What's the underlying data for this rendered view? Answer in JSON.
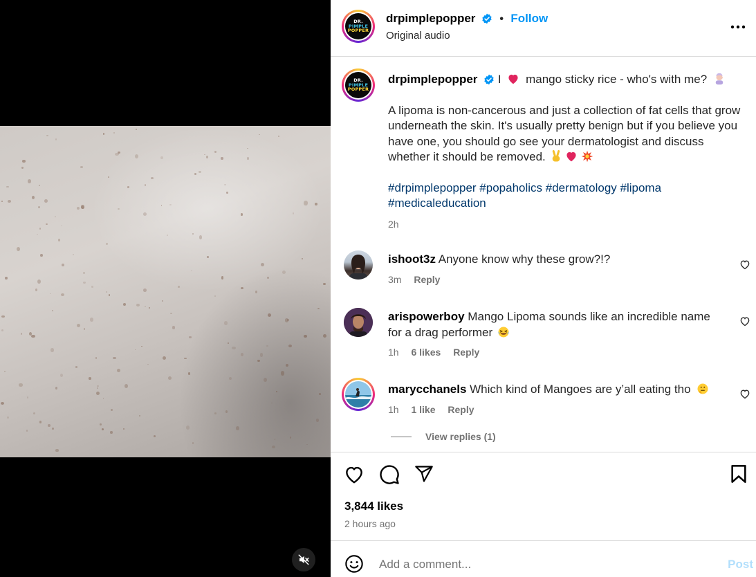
{
  "post": {
    "author": "drpimplepopper",
    "follow_label": "Follow",
    "audio": "Original audio",
    "avatar_logo": [
      "DR.",
      "PIMPLE",
      "POPPER"
    ]
  },
  "caption": {
    "author": "drpimplepopper",
    "line1_pre": "I",
    "line1_post": "mango sticky rice - who's with me?",
    "body": "A lipoma is non-cancerous and just a collection of fat cells that grow underneath the skin. It's usually pretty benign but if you believe you have one, you should go see your dermatologist and discuss whether it should be removed.",
    "hashtags_line1": "#drpimplepopper #popaholics #dermatology #lipoma",
    "hashtags_line2": "#medicaleducation",
    "time": "2h"
  },
  "comments": [
    {
      "user": "ishoot3z",
      "text": "Anyone know why these grow?!?",
      "time": "3m",
      "likes": "",
      "reply": "Reply"
    },
    {
      "user": "arispowerboy",
      "text": "Mango Lipoma sounds like an incredible name for a drag performer",
      "time": "1h",
      "likes": "6 likes",
      "reply": "Reply"
    },
    {
      "user": "marycchanels",
      "text": "Which kind of Mangoes are y’all eating tho",
      "time": "1h",
      "likes": "1 like",
      "reply": "Reply",
      "view_replies": "View replies (1)"
    }
  ],
  "stats": {
    "likes": "3,844 likes",
    "posted": "2 hours ago"
  },
  "add_comment": {
    "placeholder": "Add a comment...",
    "post_label": "Post"
  },
  "colors": {
    "link_blue": "#0095f6",
    "hashtag": "#00376b",
    "heart_red": "#e0245e",
    "verified": "#0095f6"
  }
}
